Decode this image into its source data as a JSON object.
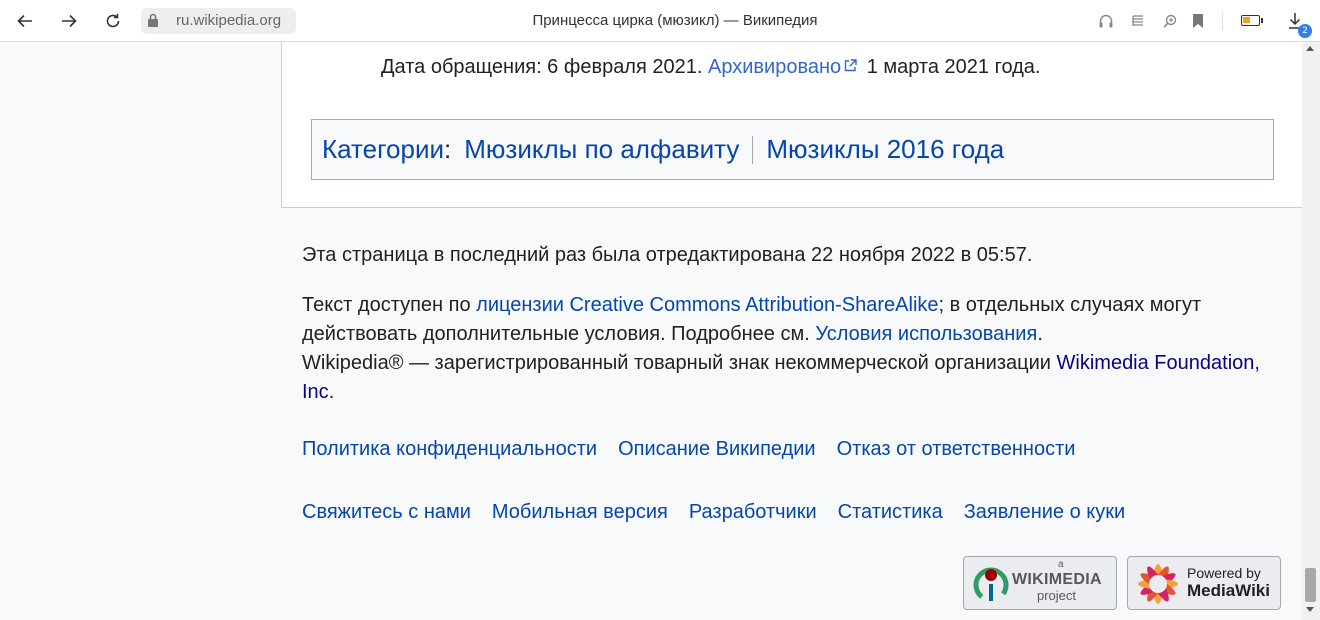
{
  "browser": {
    "url": "ru.wikipedia.org",
    "tab_title": "Принцесса цирка (мюзикл) — Википедия",
    "download_count": "2",
    "battery_level": 0.45,
    "accent": "#2f80ed"
  },
  "reference": {
    "text_before": "Дата обращения: 6 февраля 2021. ",
    "archived_link": "Архивировано",
    "text_after": " 1 марта 2021 года."
  },
  "categories": {
    "label": "Категории",
    "colon": ":",
    "items": [
      "Мюзиклы по алфавиту",
      "Мюзиклы 2016 года"
    ]
  },
  "footer": {
    "last_edited": "Эта страница в последний раз была отредактирована 22 ноября 2022 в 05:57.",
    "license_prefix": "Текст доступен по ",
    "license_link": "лицензии Creative Commons Attribution-ShareAlike",
    "license_mid": "; в отдельных случаях могут действовать дополнительные условия. Подробнее см. ",
    "terms_link": "Условия использования",
    "terms_end": ".",
    "trademark_prefix": "Wikipedia® — зарегистрированный товарный знак некоммерческой организации ",
    "wmf_link": "Wikimedia Foundation, Inc",
    "trademark_end": ".",
    "links_row1": [
      "Политика конфиденциальности",
      "Описание Википедии",
      "Отказ от ответственности"
    ],
    "links_row2": [
      "Свяжитесь с нами",
      "Мобильная версия",
      "Разработчики",
      "Статистика",
      "Заявление о куки"
    ],
    "wikimedia_badge": {
      "small": "a",
      "name": "WIKIMEDIA",
      "sub": "project"
    },
    "mediawiki_badge": {
      "line1": "Powered by",
      "line2": "MediaWiki"
    }
  }
}
